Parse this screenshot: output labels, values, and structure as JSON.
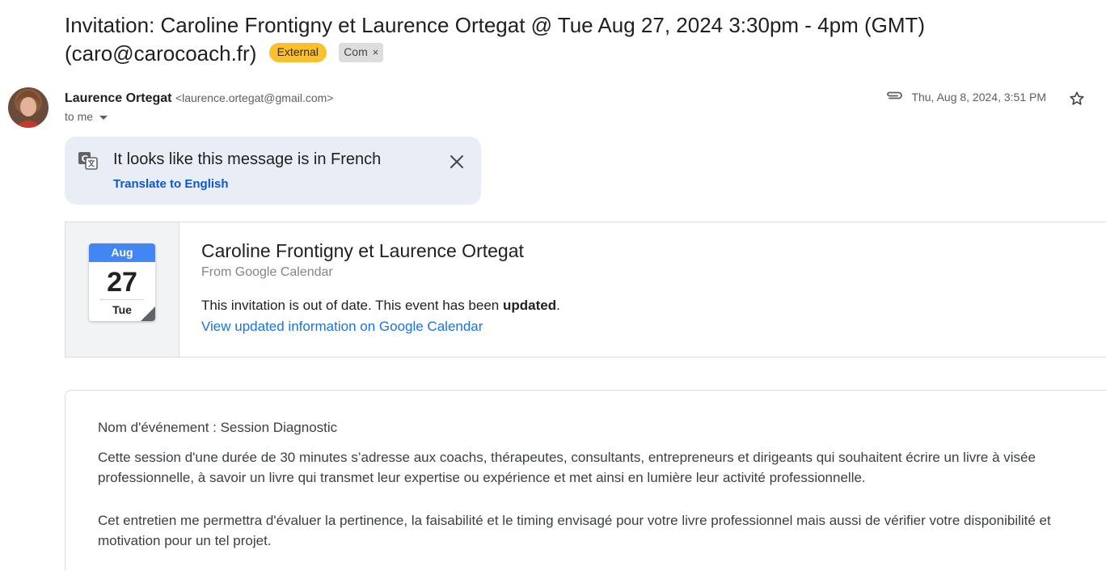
{
  "email": {
    "subject": "Invitation: Caroline Frontigny et Laurence Ortegat @ Tue Aug 27, 2024 3:30pm - 4pm (GMT) (caro@carocoach.fr)",
    "labels": {
      "external": "External",
      "category": "Com",
      "category_remove": "×"
    },
    "sender": {
      "name": "Laurence Ortegat",
      "email": "<laurence.ortegat@gmail.com>",
      "recipient": "to me"
    },
    "date": "Thu, Aug 8, 2024, 3:51 PM"
  },
  "translate_banner": {
    "message": "It looks like this message is in French",
    "action": "Translate to English"
  },
  "calendar_card": {
    "month": "Aug",
    "day": "27",
    "weekday": "Tue",
    "event_title": "Caroline Frontigny et Laurence Ortegat",
    "source": "From Google Calendar",
    "status_prefix": "This invitation is out of date. This event has been ",
    "status_bold": "updated",
    "status_suffix": ".",
    "link": "View updated information on Google Calendar"
  },
  "body": {
    "paragraphs": [
      "Nom d'événement : Session Diagnostic",
      "Cette session d'une durée de 30 minutes s’adresse aux coachs, thérapeutes, consultants, entrepreneurs et dirigeants qui souhaitent écrire un livre à visée professionnelle, à savoir un livre qui transmet leur expertise ou expérience et met ainsi en lumière leur activité professionnelle.",
      "Cet entretien me permettra d'évaluer la pertinence, la faisabilité et le timing envisagé pour votre livre professionnel mais aussi de vérifier votre disponibilité et motivation pour un tel projet."
    ]
  },
  "colors": {
    "external_chip": "#fbc02d",
    "link_blue": "#0b57d0",
    "calendar_blue": "#4285f4",
    "banner_bg": "#e9eef6"
  },
  "icons": [
    "translate-icon",
    "close-icon",
    "attachment-icon",
    "star-icon",
    "chevron-down-icon",
    "calendar-icon"
  ]
}
